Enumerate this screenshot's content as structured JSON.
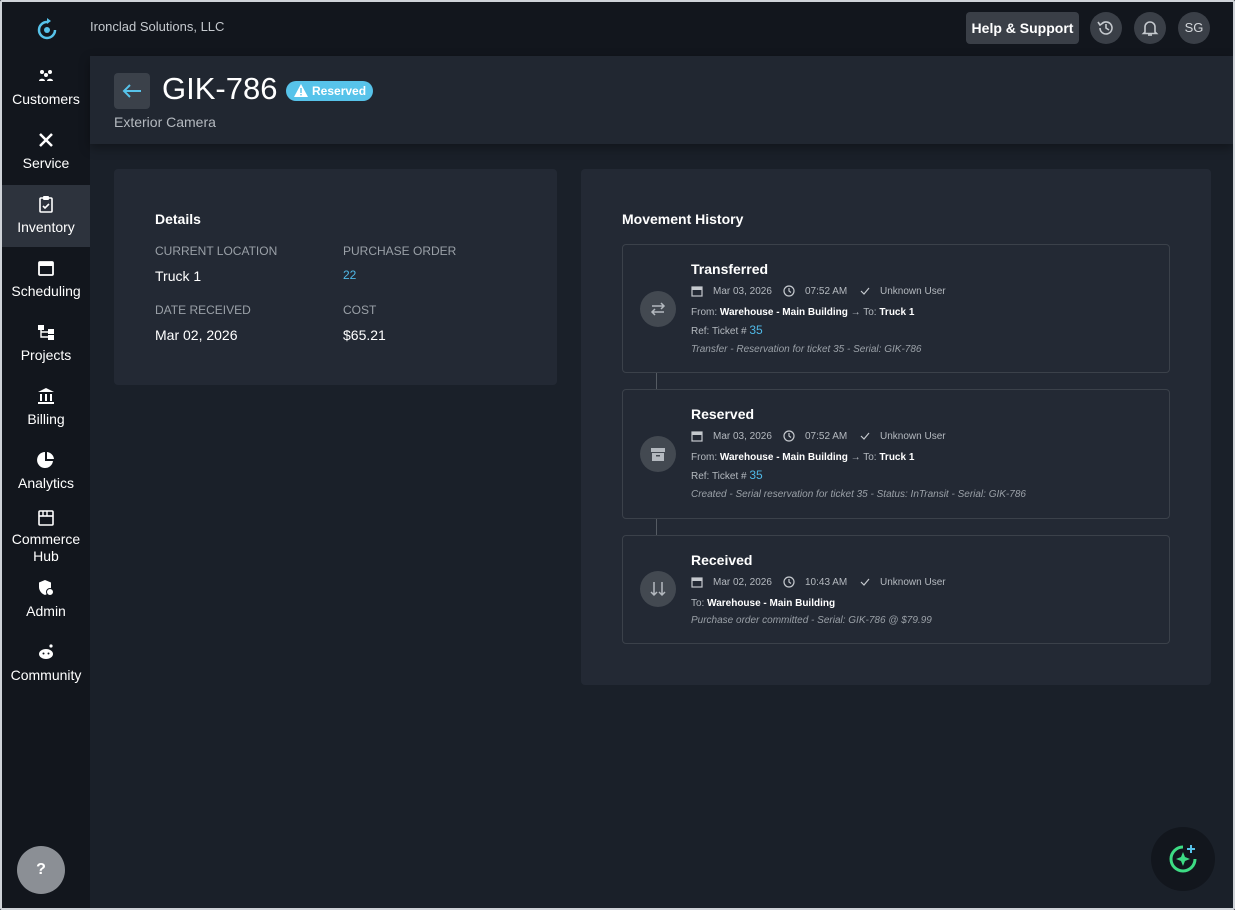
{
  "company": "Ironclad Solutions, LLC",
  "topbar": {
    "help_label": "Help & Support",
    "avatar_initials": "SG"
  },
  "sidebar": {
    "items": [
      {
        "label": "Customers",
        "icon": "customers-icon"
      },
      {
        "label": "Service",
        "icon": "service-icon"
      },
      {
        "label": "Inventory",
        "icon": "inventory-icon"
      },
      {
        "label": "Scheduling",
        "icon": "calendar-icon"
      },
      {
        "label": "Projects",
        "icon": "projects-icon"
      },
      {
        "label": "Billing",
        "icon": "billing-icon"
      },
      {
        "label": "Analytics",
        "icon": "analytics-icon"
      },
      {
        "label_line1": "Commerce",
        "label_line2": "Hub",
        "icon": "storefront-icon"
      },
      {
        "label": "Admin",
        "icon": "admin-icon"
      },
      {
        "label": "Community",
        "icon": "community-icon"
      }
    ],
    "active": "Inventory",
    "help_label": "?"
  },
  "header": {
    "title": "GIK-786",
    "status": "Reserved",
    "subtitle": "Exterior Camera"
  },
  "details": {
    "title": "Details",
    "current_location_label": "CURRENT LOCATION",
    "current_location": "Truck 1",
    "purchase_order_label": "PURCHASE ORDER",
    "purchase_order": "22",
    "date_received_label": "DATE RECEIVED",
    "date_received": "Mar 02, 2026",
    "cost_label": "COST",
    "cost": "$65.21"
  },
  "history": {
    "title": "Movement History",
    "entries": [
      {
        "title": "Transferred",
        "date": "Mar 03, 2026",
        "time": "07:52 AM",
        "user": "Unknown User",
        "from_label": "From:",
        "from": "Warehouse - Main Building",
        "to_label": "To:",
        "to": "Truck 1",
        "ref_label": "Ref: Ticket #",
        "ref": "35",
        "note": "Transfer - Reservation for ticket 35 - Serial: GIK-786"
      },
      {
        "title": "Reserved",
        "date": "Mar 03, 2026",
        "time": "07:52 AM",
        "user": "Unknown User",
        "from_label": "From:",
        "from": "Warehouse - Main Building",
        "to_label": "To:",
        "to": "Truck 1",
        "ref_label": "Ref: Ticket #",
        "ref": "35",
        "note": "Created - Serial reservation for ticket 35 - Status: InTransit - Serial: GIK-786"
      },
      {
        "title": "Received",
        "date": "Mar 02, 2026",
        "time": "10:43 AM",
        "user": "Unknown User",
        "to_label": "To:",
        "to": "Warehouse - Main Building",
        "note": "Purchase order committed - Serial: GIK-786 @ $79.99"
      }
    ]
  },
  "colors": {
    "accent": "#57c3ea",
    "link": "#4fb8e6",
    "brand_green": "#3ddc84"
  }
}
